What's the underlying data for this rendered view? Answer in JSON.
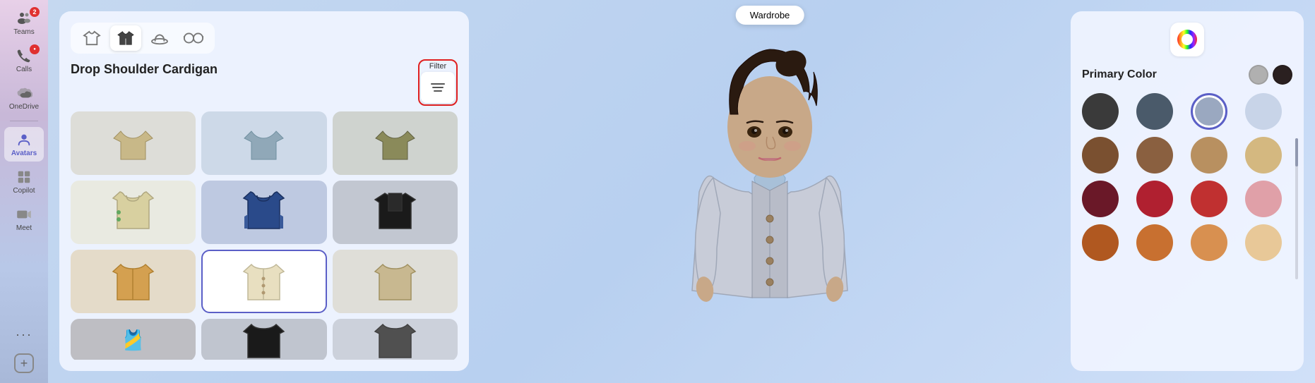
{
  "app": {
    "title": "Teams",
    "wardrobe_button": "Wardrobe"
  },
  "sidebar": {
    "items": [
      {
        "id": "teams",
        "label": "Teams",
        "icon": "👥",
        "badge": "2",
        "active": false
      },
      {
        "id": "calls",
        "label": "Calls",
        "icon": "📞",
        "badge": "●",
        "active": false
      },
      {
        "id": "onedrive",
        "label": "OneDrive",
        "icon": "☁",
        "badge": null,
        "active": false
      },
      {
        "id": "avatars",
        "label": "Avatars",
        "icon": "👤",
        "badge": null,
        "active": true
      },
      {
        "id": "copilot",
        "label": "Copilot",
        "icon": "⊞",
        "badge": null,
        "active": false
      },
      {
        "id": "meet",
        "label": "Meet",
        "icon": "📹",
        "badge": null,
        "active": false
      }
    ],
    "more_label": "...",
    "add_label": "+"
  },
  "wardrobe": {
    "tabs": [
      {
        "id": "shirt",
        "icon": "👕",
        "active": false
      },
      {
        "id": "jacket",
        "icon": "🧥",
        "active": true
      },
      {
        "id": "hat",
        "icon": "🧢",
        "active": false
      },
      {
        "id": "glasses",
        "icon": "🕶",
        "active": false
      }
    ],
    "selected_item_name": "Drop Shoulder Cardigan",
    "filter_label": "Filter",
    "items": [
      {
        "id": 1,
        "color": "#c8b88a",
        "selected": false,
        "emoji": "🧥"
      },
      {
        "id": 2,
        "color": "#a0b8c8",
        "selected": false,
        "emoji": "🧥"
      },
      {
        "id": 3,
        "color": "#8a8a6a",
        "selected": false,
        "emoji": "🧥"
      },
      {
        "id": 4,
        "color": "#e8d8a0",
        "selected": false,
        "emoji": "👚"
      },
      {
        "id": 5,
        "color": "#2a4a7a",
        "selected": false,
        "emoji": "🧥"
      },
      {
        "id": 6,
        "color": "#1a1a1a",
        "selected": false,
        "emoji": "🧥"
      },
      {
        "id": 7,
        "color": "#d4a050",
        "selected": false,
        "emoji": "🧥"
      },
      {
        "id": 8,
        "color": "#e8dfc0",
        "selected": true,
        "emoji": "🧥"
      },
      {
        "id": 9,
        "color": "#c8b890",
        "selected": false,
        "emoji": "🧥"
      },
      {
        "id": 10,
        "color": "#3a2a1a",
        "selected": false,
        "emoji": "🎽"
      },
      {
        "id": 11,
        "color": "#1a1a1a",
        "selected": false,
        "emoji": "🧥"
      },
      {
        "id": 12,
        "color": "#606060",
        "selected": false,
        "emoji": "🧥"
      }
    ]
  },
  "color_panel": {
    "title": "Primary Color",
    "preview_colors": [
      "#b0b0b0",
      "#2a2020"
    ],
    "swatches": [
      {
        "id": 1,
        "color": "#3a3a3a",
        "selected": false
      },
      {
        "id": 2,
        "color": "#4a5a6a",
        "selected": false
      },
      {
        "id": 3,
        "color": "#9aa8c0",
        "selected": true
      },
      {
        "id": 4,
        "color": "#c8d4e8",
        "selected": false
      },
      {
        "id": 5,
        "color": "#7a5030",
        "selected": false
      },
      {
        "id": 6,
        "color": "#8a6040",
        "selected": false
      },
      {
        "id": 7,
        "color": "#b89060",
        "selected": false
      },
      {
        "id": 8,
        "color": "#d4b880",
        "selected": false
      },
      {
        "id": 9,
        "color": "#6a1828",
        "selected": false
      },
      {
        "id": 10,
        "color": "#b02030",
        "selected": false
      },
      {
        "id": 11,
        "color": "#c03030",
        "selected": false
      },
      {
        "id": 12,
        "color": "#e0a0a8",
        "selected": false
      },
      {
        "id": 13,
        "color": "#b05820",
        "selected": false
      },
      {
        "id": 14,
        "color": "#c87030",
        "selected": false
      },
      {
        "id": 15,
        "color": "#d89050",
        "selected": false
      },
      {
        "id": 16,
        "color": "#e8c898",
        "selected": false
      }
    ]
  }
}
